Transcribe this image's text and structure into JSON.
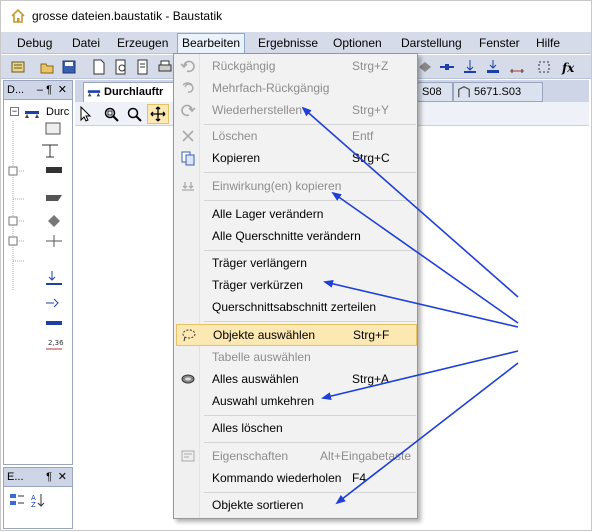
{
  "window": {
    "title": "grosse dateien.baustatik - Baustatik"
  },
  "menubar": {
    "items": [
      "Debug",
      "Datei",
      "Erzeugen",
      "Bearbeiten",
      "Ergebnisse",
      "Optionen",
      "Darstellung",
      "Fenster",
      "Hilfe"
    ],
    "open_item": "Bearbeiten"
  },
  "left_panel": {
    "title": "D...",
    "pin": "‒ ¶",
    "close": "✕",
    "tree_root_label": "Durc"
  },
  "left_panel2": {
    "title": "E...",
    "pin": "¶",
    "close": "✕"
  },
  "doc_tabs": [
    {
      "label": "Durchlauftr"
    },
    {
      "label": "S08"
    },
    {
      "label": "5671.S03"
    }
  ],
  "menu": {
    "items": [
      {
        "label": "Rückgängig",
        "shortcut": "Strg+Z",
        "disabled": true,
        "icon": "undo-icon"
      },
      {
        "label": "Mehrfach-Rückgängig",
        "shortcut": "",
        "disabled": true,
        "icon": "multi-undo-icon"
      },
      {
        "label": "Wiederherstellen",
        "shortcut": "Strg+Y",
        "disabled": true,
        "icon": "redo-icon"
      },
      {
        "label": "Löschen",
        "shortcut": "Entf",
        "disabled": true,
        "icon": "delete-icon"
      },
      {
        "label": "Kopieren",
        "shortcut": "Strg+C",
        "disabled": false,
        "icon": "copy-icon"
      },
      {
        "label": "Einwirkung(en) kopieren",
        "shortcut": "",
        "disabled": true,
        "icon": "copy-actions-icon"
      },
      {
        "label": "Alle Lager verändern",
        "shortcut": "",
        "disabled": false,
        "icon": ""
      },
      {
        "label": "Alle Querschnitte verändern",
        "shortcut": "",
        "disabled": false,
        "icon": ""
      },
      {
        "label": "Träger verlängern",
        "shortcut": "",
        "disabled": false,
        "icon": ""
      },
      {
        "label": "Träger verkürzen",
        "shortcut": "",
        "disabled": false,
        "icon": ""
      },
      {
        "label": "Querschnittsabschnitt zerteilen",
        "shortcut": "",
        "disabled": false,
        "icon": ""
      },
      {
        "label": "Objekte auswählen",
        "shortcut": "Strg+F",
        "disabled": false,
        "icon": "lasso-icon",
        "highlighted": true
      },
      {
        "label": "Tabelle auswählen",
        "shortcut": "",
        "disabled": true,
        "icon": ""
      },
      {
        "label": "Alles auswählen",
        "shortcut": "Strg+A",
        "disabled": false,
        "icon": "select-all-icon"
      },
      {
        "label": "Auswahl umkehren",
        "shortcut": "",
        "disabled": false,
        "icon": ""
      },
      {
        "label": "Alles löschen",
        "shortcut": "",
        "disabled": false,
        "icon": ""
      },
      {
        "label": "Eigenschaften",
        "shortcut": "Alt+Eingabetaste",
        "disabled": true,
        "icon": "properties-icon"
      },
      {
        "label": "Kommando wiederholen",
        "shortcut": "F4",
        "disabled": false,
        "icon": ""
      },
      {
        "label": "Objekte sortieren",
        "shortcut": "",
        "disabled": false,
        "icon": ""
      }
    ]
  },
  "colors": {
    "arrow": "#1f3fd6",
    "highlight": "#fce8b2",
    "menubar": "#d6dbe9"
  }
}
